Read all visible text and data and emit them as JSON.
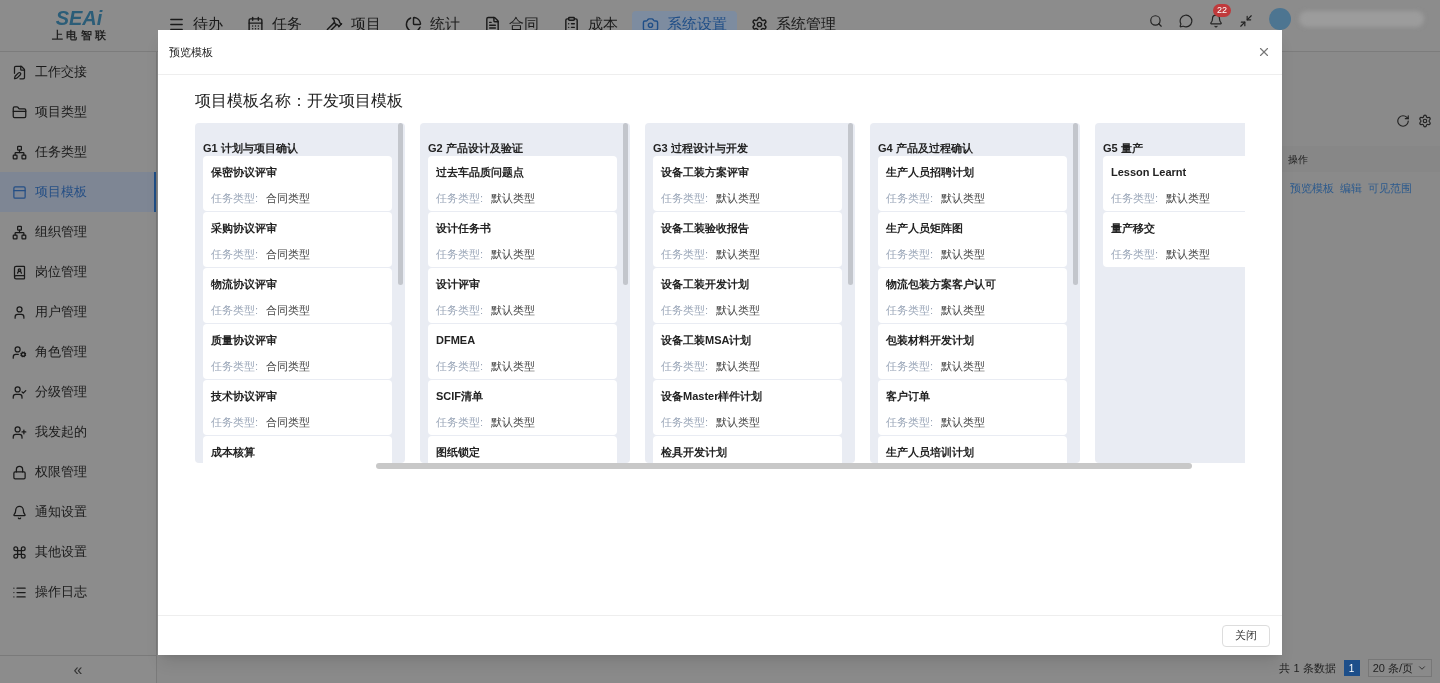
{
  "logo": {
    "mark": "SEAi",
    "caption": "上 电 智 联"
  },
  "top_nav": [
    {
      "label": "待办",
      "selected": false
    },
    {
      "label": "任务",
      "selected": false
    },
    {
      "label": "项目",
      "selected": false
    },
    {
      "label": "统计",
      "selected": false
    },
    {
      "label": "合同",
      "selected": false
    },
    {
      "label": "成本",
      "selected": false
    },
    {
      "label": "系统设置",
      "selected": true
    },
    {
      "label": "系统管理",
      "selected": false
    }
  ],
  "notifications": {
    "badge": "22"
  },
  "sidebar": {
    "items": [
      {
        "label": "工作交接",
        "selected": false
      },
      {
        "label": "项目类型",
        "selected": false
      },
      {
        "label": "任务类型",
        "selected": false
      },
      {
        "label": "项目模板",
        "selected": true
      },
      {
        "label": "组织管理",
        "selected": false
      },
      {
        "label": "岗位管理",
        "selected": false
      },
      {
        "label": "用户管理",
        "selected": false
      },
      {
        "label": "角色管理",
        "selected": false
      },
      {
        "label": "分级管理",
        "selected": false
      },
      {
        "label": "我发起的",
        "selected": false
      },
      {
        "label": "权限管理",
        "selected": false
      },
      {
        "label": "通知设置",
        "selected": false
      },
      {
        "label": "其他设置",
        "selected": false
      },
      {
        "label": "操作日志",
        "selected": false
      }
    ],
    "collapse": "«"
  },
  "table": {
    "columns": [
      "操作"
    ],
    "actions": [
      "预览模板",
      "编辑",
      "可见范围"
    ]
  },
  "pagination": {
    "total": "共 1 条数据",
    "pages": [
      {
        "label": "1",
        "selected": true
      }
    ],
    "page_size": "20 条/页"
  },
  "dialog": {
    "title": "预览模板",
    "heading": "项目模板名称：开发项目模板",
    "columns": [
      {
        "title": "G1 计划与项目确认",
        "tasks": [
          {
            "name": "保密协议评审",
            "type_label": "任务类型:",
            "type": "合同类型"
          },
          {
            "name": "采购协议评审",
            "type_label": "任务类型:",
            "type": "合同类型"
          },
          {
            "name": "物流协议评审",
            "type_label": "任务类型:",
            "type": "合同类型"
          },
          {
            "name": "质量协议评审",
            "type_label": "任务类型:",
            "type": "合同类型"
          },
          {
            "name": "技术协议评审",
            "type_label": "任务类型:",
            "type": "合同类型"
          },
          {
            "name": "成本核算"
          }
        ]
      },
      {
        "title": "G2 产品设计及验证",
        "tasks": [
          {
            "name": "过去车品质问题点",
            "type_label": "任务类型:",
            "type": "默认类型"
          },
          {
            "name": "设计任务书",
            "type_label": "任务类型:",
            "type": "默认类型"
          },
          {
            "name": "设计评审",
            "type_label": "任务类型:",
            "type": "默认类型"
          },
          {
            "name": "DFMEA",
            "type_label": "任务类型:",
            "type": "默认类型"
          },
          {
            "name": "SCIF清单",
            "type_label": "任务类型:",
            "type": "默认类型"
          },
          {
            "name": "图纸锁定"
          }
        ]
      },
      {
        "title": "G3 过程设计与开发",
        "tasks": [
          {
            "name": "设备工装方案评审",
            "type_label": "任务类型:",
            "type": "默认类型"
          },
          {
            "name": "设备工装验收报告",
            "type_label": "任务类型:",
            "type": "默认类型"
          },
          {
            "name": "设备工装开发计划",
            "type_label": "任务类型:",
            "type": "默认类型"
          },
          {
            "name": "设备工装MSA计划",
            "type_label": "任务类型:",
            "type": "默认类型"
          },
          {
            "name": "设备Master样件计划",
            "type_label": "任务类型:",
            "type": "默认类型"
          },
          {
            "name": "检具开发计划"
          }
        ]
      },
      {
        "title": "G4 产品及过程确认",
        "tasks": [
          {
            "name": "生产人员招聘计划",
            "type_label": "任务类型:",
            "type": "默认类型"
          },
          {
            "name": "生产人员矩阵图",
            "type_label": "任务类型:",
            "type": "默认类型"
          },
          {
            "name": "物流包装方案客户认可",
            "type_label": "任务类型:",
            "type": "默认类型"
          },
          {
            "name": "包装材料开发计划",
            "type_label": "任务类型:",
            "type": "默认类型"
          },
          {
            "name": "客户订单",
            "type_label": "任务类型:",
            "type": "默认类型"
          },
          {
            "name": "生产人员培训计划"
          }
        ]
      },
      {
        "title": "G5 量产",
        "tasks": [
          {
            "name": "Lesson Learnt",
            "type_label": "任务类型:",
            "type": "默认类型"
          },
          {
            "name": "量产移交",
            "type_label": "任务类型:",
            "type": "默认类型"
          }
        ]
      }
    ],
    "close_button": "关闭"
  }
}
